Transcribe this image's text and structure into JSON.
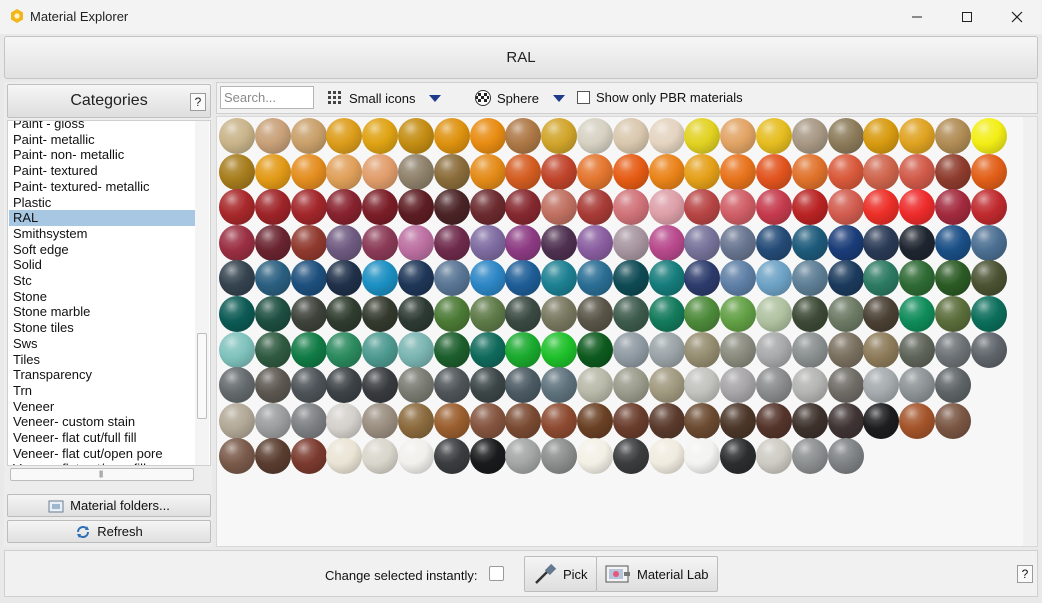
{
  "window": {
    "title": "Material Explorer"
  },
  "header": {
    "title": "RAL"
  },
  "categories": {
    "title": "Categories",
    "help_label": "?",
    "items": [
      "Paint - gloss",
      "Paint- metallic",
      "Paint- non- metallic",
      "Paint- textured",
      "Paint- textured- metallic",
      "Plastic",
      "RAL",
      "Smithsystem",
      "Soft edge",
      "Solid",
      "Stc",
      "Stone",
      "Stone marble",
      "Stone tiles",
      "Sws",
      "Tiles",
      "Transparency",
      "Trn",
      "Veneer",
      "Veneer- custom stain",
      "Veneer- flat cut/full fill",
      "Veneer- flat cut/open pore",
      "Veneer- flat cut/pore fill"
    ],
    "selected_index": 6
  },
  "side_buttons": {
    "folders_label": "Material folders...",
    "refresh_label": "Refresh"
  },
  "toolbar": {
    "search_placeholder": "Search...",
    "view_size_label": "Small icons",
    "shape_label": "Sphere",
    "pbr_label": "Show only PBR materials",
    "pbr_checked": false
  },
  "swatches": [
    [
      "#c9b48a",
      "#c8a078",
      "#c9a06a",
      "#dd9d1b",
      "#dfa313",
      "#c48d13",
      "#de920f",
      "#e88c12",
      "#ae7846",
      "#d1a52b",
      "#d6d1c2",
      "#d9c8ae",
      "#e4d4c0",
      "#e2d222",
      "#e2a464",
      "#e6bd20",
      "#a89884",
      "#8c7b5a",
      "#d89b10",
      "#dfa321",
      "#b18c55",
      "#f3ee16"
    ],
    [
      "#a77d1d",
      "#e29a17",
      "#e48d1f",
      "#e0a05a",
      "#e19d6b",
      "#8f816b",
      "#8a6c3a",
      "#e48b18",
      "#d45d21",
      "#c0442b",
      "#e4762f",
      "#e65c14",
      "#ea8319",
      "#e5a019",
      "#e8731c",
      "#e2541e",
      "#e0722b",
      "#d9593a",
      "#cf654d",
      "#d15a49",
      "#8e3c2d",
      "#e25f18"
    ],
    [
      "#a8282a",
      "#9e2428",
      "#a2262a",
      "#87222e",
      "#7b1d27",
      "#5d1d22",
      "#4a2326",
      "#6b2a2e",
      "#86282f",
      "#c07061",
      "#a83b36",
      "#d07379",
      "#dd9fa8",
      "#b84545",
      "#d05e66",
      "#c53b4d",
      "#ba2323",
      "#d25c4f",
      "#ec2f27",
      "#ee2b2b",
      "#a32a3e",
      "#c02a2e"
    ],
    [
      "#9a2f42",
      "#6a2430",
      "#90392e",
      "#6f5a80",
      "#8b3a56",
      "#bc6fa1",
      "#6e2a4b",
      "#7e6ba1",
      "#8d3b83",
      "#4e3050",
      "#8a5ea0",
      "#a7959f",
      "#b8498c",
      "#76729a",
      "#687590",
      "#244b77",
      "#1d5a7a",
      "#1a3c78",
      "#2a3a55",
      "#1f2530",
      "#1a4f86",
      "#4b6f92"
    ],
    [
      "#34434f",
      "#2a5f80",
      "#1d4f7d",
      "#1f3049",
      "#1b8fc2",
      "#1e3657",
      "#587594",
      "#2c86c5",
      "#1e5d97",
      "#1c8092",
      "#2a6e94",
      "#0e4a54",
      "#157c7b",
      "#2c3b6c",
      "#5e7fa6",
      "#6da2c5",
      "#5d7e95",
      "#1b3a5c",
      "#2c7a62",
      "#2e6a33",
      "#2b5a24",
      "#4b5232"
    ],
    [
      "#0c5a54",
      "#1d4e40",
      "#3d423a",
      "#2f3c2e",
      "#333a2d",
      "#2d3a33",
      "#4b7a35",
      "#5e7a48",
      "#3a4a42",
      "#787860",
      "#5a5548",
      "#3d5b4c",
      "#137a5b",
      "#4d8a3a",
      "#62a045",
      "#afc2a0",
      "#3d4a36",
      "#6c7a64",
      "#4a4033",
      "#0f8c5a",
      "#5a6d3a",
      "#0b6e5b"
    ],
    [
      "#7fc2bd",
      "#2f5a40",
      "#107b45",
      "#2b8a5e",
      "#4d9a90",
      "#7ab5b2",
      "#1c5e2c",
      "#0f6a5b",
      "#1aaa2e",
      "#1ec02a",
      "#0d5a1e",
      "#8f9aa2",
      "#9aa3a7",
      "#958d70",
      "#8a8b7e",
      "#a8a9aa",
      "#8a8f8f",
      "#7a7060",
      "#8d7b5a",
      "#5e6459",
      "#6d7276",
      "#5e646a"
    ],
    [
      "#646a6d",
      "#5c5750",
      "#4d5358",
      "#3c4246",
      "#383b3f",
      "#7a7b72",
      "#4e5458",
      "#3c4647",
      "#4b5a63",
      "#5e727d",
      "#b8b9a8",
      "#9a9b8b",
      "#a19a80",
      "#c2c3be",
      "#a7a5a8",
      "#8a8b8c",
      "#b4b5b2",
      "#6f6c66",
      "#a5abae",
      "#8d9396",
      "#5e6466"
    ],
    [
      "#b2a897",
      "#9b9d9e",
      "#7d8083",
      "#d4d1cc",
      "#9a8e80",
      "#8b6a3d",
      "#9a5e2e",
      "#84543e",
      "#7a4a32",
      "#8d4a30",
      "#6a4024",
      "#6a3d2c",
      "#5a3a2c",
      "#6b4a30",
      "#4b3628",
      "#54342a",
      "#3d312b",
      "#3f3433",
      "#1d1c1e",
      "#a4542a",
      "#7a5643"
    ],
    [
      "#7a5a4a",
      "#5a3d2f",
      "#7b3a2e",
      "#eae4d5",
      "#d9d6cc",
      "#f2f0ec",
      "#3a3c3f",
      "#191a1b",
      "#a3a6a5",
      "#8c8e8e",
      "#f3f0e6",
      "#3a3c3e",
      "#f1ece0",
      "#f3f3f2",
      "#2b2d2e",
      "#cdcbc3",
      "#8c8f90",
      "#7e8284"
    ]
  ],
  "bottom": {
    "change_label": "Change selected instantly:",
    "pick_label": "Pick",
    "lab_label": "Material Lab",
    "help_label": "?"
  }
}
